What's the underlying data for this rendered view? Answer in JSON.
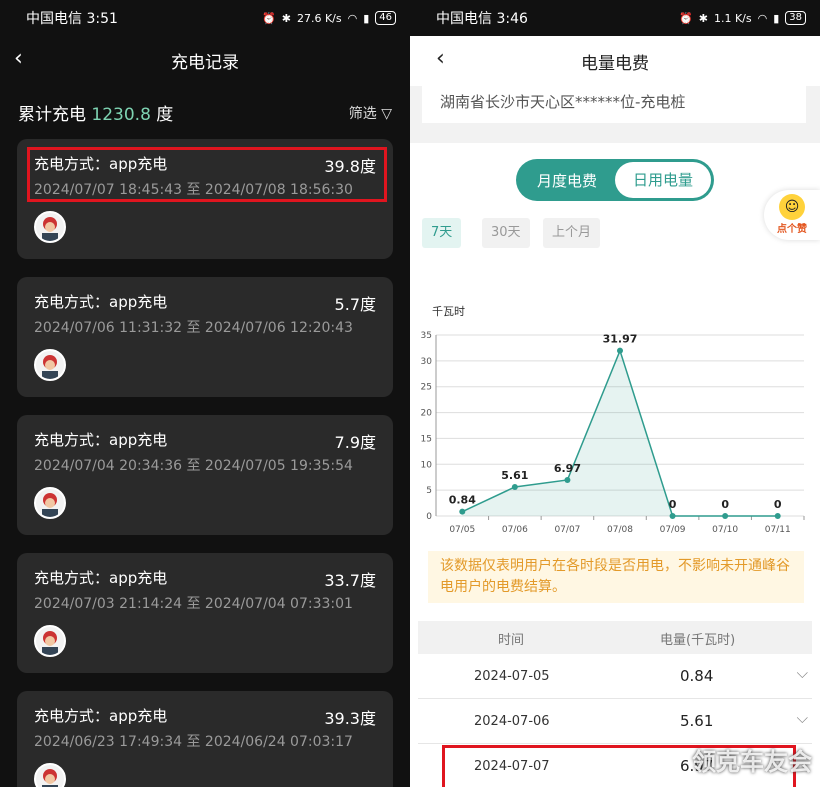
{
  "left": {
    "status": {
      "carrier": "中国电信 3:51",
      "signal": "27.6 K/s",
      "battery": "46"
    },
    "title": "充电记录",
    "summary_label": "累计充电",
    "summary_value": "1230.8",
    "summary_unit": "度",
    "filter_label": "筛选",
    "records": [
      {
        "method": "充电方式：app充电",
        "energy": "39.8度",
        "time": "2024/07/07 18:45:43 至 2024/07/08 18:56:30"
      },
      {
        "method": "充电方式：app充电",
        "energy": "5.7度",
        "time": "2024/07/06 11:31:32 至 2024/07/06 12:20:43"
      },
      {
        "method": "充电方式：app充电",
        "energy": "7.9度",
        "time": "2024/07/04 20:34:36 至 2024/07/05 19:35:54"
      },
      {
        "method": "充电方式：app充电",
        "energy": "33.7度",
        "time": "2024/07/03 21:14:24 至 2024/07/04 07:33:01"
      },
      {
        "method": "充电方式：app充电",
        "energy": "39.3度",
        "time": "2024/06/23 17:49:34 至 2024/06/24 07:03:17"
      }
    ]
  },
  "right": {
    "status": {
      "carrier": "中国电信 3:46",
      "signal": "1.1 K/s",
      "battery": "38"
    },
    "title": "电量电费",
    "address": "湖南省长沙市天心区******位-充电桩",
    "toggle": {
      "monthly": "月度电费",
      "daily": "日用电量"
    },
    "ranges": [
      "7天",
      "30天",
      "上个月"
    ],
    "like_label": "点个赞",
    "notice": "该数据仅表明用户在各时段是否用电，不影响未开通峰谷电用户的电费结算。",
    "table_headers": {
      "time": "时间",
      "energy": "电量(千瓦时)"
    },
    "table_rows": [
      {
        "date": "2024-07-05",
        "value": "0.84"
      },
      {
        "date": "2024-07-06",
        "value": "5.61"
      },
      {
        "date": "2024-07-07",
        "value": "6.97"
      }
    ]
  },
  "watermark": "领克车友会",
  "colors": {
    "accent": "#2f9c8e",
    "highlight": "#e0151f",
    "left_accent": "#7ed3b2",
    "notice_text": "#e39a2a"
  },
  "chart_data": {
    "type": "area",
    "ylabel": "千瓦时",
    "x": [
      "07/05",
      "07/06",
      "07/07",
      "07/08",
      "07/09",
      "07/10",
      "07/11"
    ],
    "values": [
      0.84,
      5.61,
      6.97,
      31.97,
      0,
      0,
      0
    ],
    "yticks": [
      0,
      5,
      10,
      15,
      20,
      25,
      30,
      35
    ],
    "ylim": [
      0,
      35
    ],
    "grid": true
  }
}
